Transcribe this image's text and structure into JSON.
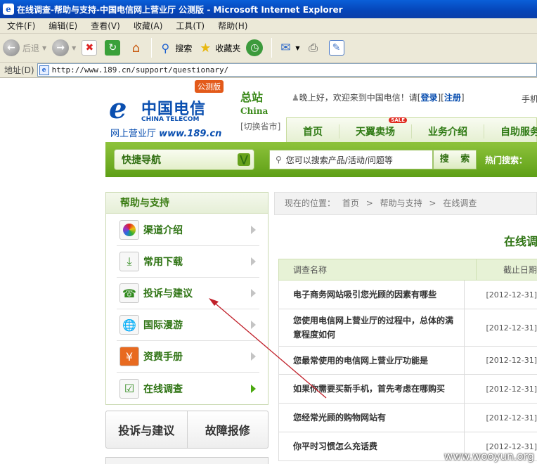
{
  "window": {
    "title": "在线调查-帮助与支持-中国电信网上营业厅 公测版 - Microsoft Internet Explorer"
  },
  "menubar": [
    "文件(F)",
    "编辑(E)",
    "查看(V)",
    "收藏(A)",
    "工具(T)",
    "帮助(H)"
  ],
  "toolbar": {
    "back_label": "后退",
    "search_label": "搜索",
    "favorites_label": "收藏夹"
  },
  "address": {
    "label": "地址(D)",
    "url": "http://www.189.cn/support/questionary/"
  },
  "header": {
    "logo_cn": "中国电信",
    "logo_en": "CHINA TELECOM",
    "logo_sub": "网上营业厅",
    "logo_url": "www.189.cn",
    "beta_badge": "公测版",
    "region_name": "总站",
    "region_en": "China",
    "region_switch": "[切换省市]",
    "greeting_prefix": "晚上好，欢迎来到中国电信！请[",
    "login": "登录",
    "register": "注册",
    "greeting_suffix": "]",
    "phone_top": "手机"
  },
  "mainnav": [
    {
      "label": "首页"
    },
    {
      "label": "天翼卖场",
      "badge": "SALE"
    },
    {
      "label": "业务介绍"
    },
    {
      "label": "自助服务"
    }
  ],
  "quicknav": {
    "label": "快捷导航",
    "search_placeholder": "您可以搜索产品/活动/问题等",
    "search_button": "搜 索",
    "hot_label": "热门搜索："
  },
  "sidebar": {
    "title": "帮助与支持",
    "items": [
      {
        "label": "渠道介绍",
        "icon": "color-wheel-icon"
      },
      {
        "label": "常用下载",
        "icon": "download-icon"
      },
      {
        "label": "投诉与建议",
        "icon": "phone-icon"
      },
      {
        "label": "国际漫游",
        "icon": "globe-icon"
      },
      {
        "label": "资费手册",
        "icon": "yuan-icon"
      },
      {
        "label": "在线调查",
        "icon": "survey-icon"
      }
    ],
    "bottom_buttons": [
      "投诉与建议",
      "故障报修"
    ]
  },
  "breadcrumb": {
    "prefix": "现在的位置：",
    "items": [
      "首页",
      "帮助与支持",
      "在线调查"
    ],
    "separator": ">"
  },
  "survey": {
    "title": "在线调查",
    "col_name": "调查名称",
    "col_date": "截止日期",
    "rows": [
      {
        "name": "电子商务网站吸引您光顾的因素有哪些",
        "date": "[2012-12-31]"
      },
      {
        "name": "您使用电信网上营业厅的过程中，总体的满意程度如何",
        "date": "[2012-12-31]"
      },
      {
        "name": "您最常使用的电信网上营业厅功能是",
        "date": "[2012-12-31]"
      },
      {
        "name": "如果你需要买新手机，首先考虑在哪购买",
        "date": "[2012-12-31]"
      },
      {
        "name": "您经常光顾的购物网站有",
        "date": "[2012-12-31]"
      },
      {
        "name": "你平时习惯怎么充话费",
        "date": "[2012-12-31]"
      }
    ]
  },
  "watermark": "www.wooyun.org",
  "colors": {
    "brand_green": "#5e9f16",
    "nav_text": "#2f7a14",
    "telecom_blue": "#0a4fb0",
    "annotation_red": "#c0202a"
  }
}
